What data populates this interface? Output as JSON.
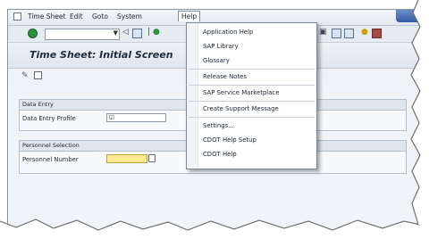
{
  "menubar": {
    "items": [
      "Time Sheet",
      "Edit",
      "Goto",
      "System",
      "Help"
    ]
  },
  "title": "Time Sheet: Initial Screen",
  "groups": {
    "data_entry": {
      "header": "Data Entry",
      "profile_label": "Data Entry Profile",
      "profile_value": "☑"
    },
    "personnel": {
      "header": "Personnel Selection",
      "number_label": "Personnel Number",
      "number_value": ""
    }
  },
  "help_menu": {
    "items": [
      "Application Help",
      "SAP Library",
      "Glossary",
      "Release Notes",
      "SAP Service Marketplace",
      "Create Support Message",
      "Settings...",
      "CDOT Help Setup",
      "CDOT Help"
    ]
  },
  "colors": {
    "required_field": "#fbe88f",
    "frame_background": "#f0f3f7",
    "window_button": "#2f5aa5"
  },
  "icons": [
    "app-menu-icon",
    "ok-check-icon",
    "back-icon",
    "save-icon",
    "pencil-icon",
    "tree-icon",
    "search-help-icon"
  ]
}
